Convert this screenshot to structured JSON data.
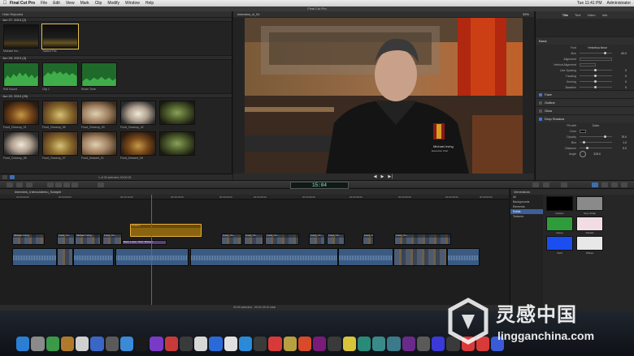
{
  "menubar": {
    "items": [
      "Final Cut Pro",
      "File",
      "Edit",
      "View",
      "Mark",
      "Clip",
      "Modify",
      "Window",
      "Help"
    ],
    "right": [
      "Tue 11:41 PM",
      "Administrator"
    ]
  },
  "window_title": "Final Cut Pro",
  "browser": {
    "filter_label": "Hide Rejected",
    "events": [
      {
        "label": "Jun 27, 2013  (2)",
        "clips": [
          "Michael Inn... ",
          "Tabard Fire"
        ]
      },
      {
        "label": "Jun 25, 2013  (3)",
        "clips": [
          "Roll Sound",
          "Clip 1",
          "Room Tone"
        ]
      },
      {
        "label": "Jun 22, 2013  (25)",
        "clips": [
          "Food_Closeup_01",
          "Food_Closeup_06",
          "Food_Closeup_03",
          "Food_Closeup_02",
          "",
          "Food_Closeup_08",
          "Food_Closeup_07",
          "Food_Dessert_01",
          "Food_Dessert_05",
          ""
        ]
      }
    ],
    "footer_text": "1 of 30 selected, 00:00:15"
  },
  "viewer": {
    "title": "Interview_A_01",
    "zoom": "39%",
    "video_name_card": "Michael Irving",
    "video_name_sub": "Executive Chef"
  },
  "inspector": {
    "tabs": [
      "Title",
      "Text",
      "Video",
      "Info"
    ],
    "sections": {
      "basic": "Basic",
      "face": "Face",
      "outline": "Outline",
      "glow": "Glow",
      "drop_shadow": "Drop Shadow"
    },
    "basic_rows": [
      {
        "label": "Font",
        "value": "Helvetica Neue"
      },
      {
        "label": "Size",
        "value": "63.0"
      },
      {
        "label": "Alignment",
        "value": ""
      },
      {
        "label": "Vertical Alignment",
        "value": ""
      },
      {
        "label": "Line Spacing",
        "value": "0"
      },
      {
        "label": "Tracking",
        "value": "0"
      },
      {
        "label": "Kerning",
        "value": "0"
      },
      {
        "label": "Baseline",
        "value": "0"
      }
    ],
    "shadow_rows": [
      {
        "label": "Fill with",
        "value": "Color"
      },
      {
        "label": "Color",
        "value": ""
      },
      {
        "label": "Opacity",
        "value": "75.0"
      },
      {
        "label": "Blur",
        "value": "1.0"
      },
      {
        "label": "Distance",
        "value": "5.0"
      },
      {
        "label": "Angle",
        "value": "315.0"
      }
    ]
  },
  "timecode": "15:04",
  "timeline": {
    "project_name": "Interview_Intercutdemo_Sample",
    "ruler": [
      "00:00:00:00",
      "00:00:05:00",
      "00:00:10:00",
      "00:00:15:00",
      "00:00:20:00",
      "00:00:25:00",
      "00:00:30:00",
      "00:00:35:00",
      "00:00:40:00",
      "00:00:45:00",
      "00:00:50:00",
      "00:00:55:00"
    ],
    "title_clip": "Custom",
    "lower_third": "Basic Lower Third: Michael",
    "conn_clips": [
      "Michael Irving",
      "Food_Clo...",
      "Michael Irving",
      "Food_Clo...",
      "Food_Clo...",
      "Food_Clo...",
      "Food_Clo...",
      "Food_Clo...",
      "Food_Clo...",
      "Food_Clo...",
      "Food_Clo..."
    ],
    "footer": "00:00 selected - 00:01:09:10 total"
  },
  "generators": {
    "header": "Generators",
    "categories": [
      "All",
      "Backgrounds",
      "Elements",
      "Solids",
      "Textures"
    ],
    "selected_category": "Solids",
    "swatches": [
      {
        "name": "Custom",
        "color": "#000000"
      },
      {
        "name": "Grey Scale",
        "color": "#8a8a8a"
      },
      {
        "name": "Green",
        "color": "#2e9c3a"
      },
      {
        "name": "Pastels",
        "color": "#f2dde6"
      },
      {
        "name": "Vivid",
        "color": "#1a4ef0"
      },
      {
        "name": "Whites",
        "color": "#e8e8e8"
      }
    ]
  },
  "watermark": {
    "title": "灵感中国",
    "url": "lingganchina.com"
  },
  "dock_colors": [
    "#2a7fd4",
    "#8a8a8a",
    "#3a9a48",
    "#b07a2a",
    "#d0d0d0",
    "#3a66c8",
    "#5a5a5a",
    "#3a8ad8",
    "#1a1a1a",
    "#7a3ac8",
    "#c83a3a",
    "#3a3a3a",
    "#d8d8d8",
    "#2a6ad8",
    "#e0e0e0",
    "#2a8ad8",
    "#3a3a3a",
    "#d83a3a",
    "#b8a040",
    "#d84a2a",
    "#7a1a7a",
    "#3a3a3a",
    "#d8c43a",
    "#2a8a7a",
    "#3a8a8a",
    "#3a7a8a",
    "#6a2a8a",
    "#5a5a5a",
    "#3a3ad8",
    "#3a3a3a",
    "#d83a3a",
    "#d83a3a",
    "#3a5ad8"
  ]
}
